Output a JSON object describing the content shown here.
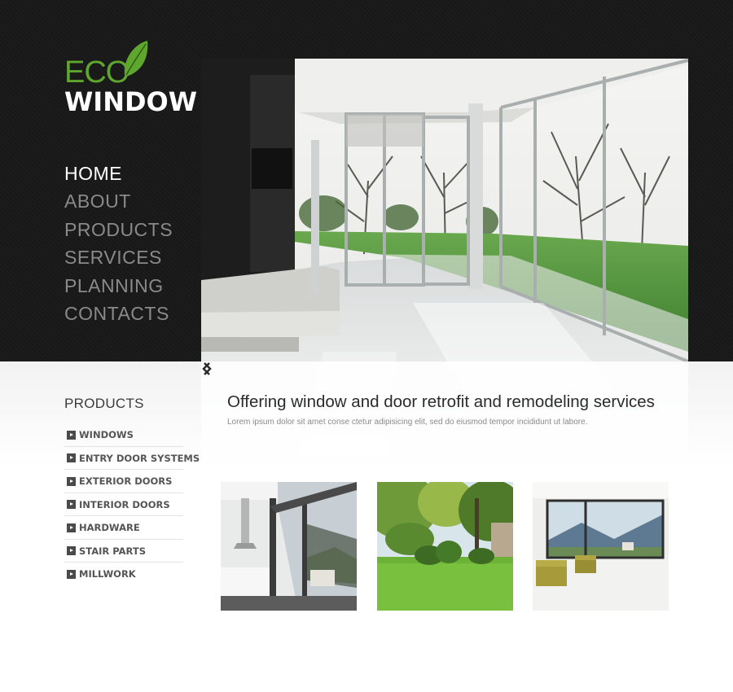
{
  "logo": {
    "eco": "ECO",
    "window": "WINDOW",
    "icon": "leaf-icon",
    "eco_color": "#5fa62f"
  },
  "nav": {
    "items": [
      {
        "label": "HOME",
        "active": true
      },
      {
        "label": "ABOUT",
        "active": false
      },
      {
        "label": "PRODUCTS",
        "active": false
      },
      {
        "label": "SERVICES",
        "active": false
      },
      {
        "label": "PLANNING",
        "active": false
      },
      {
        "label": "CONTACTS",
        "active": false
      }
    ]
  },
  "hero": {
    "title": "Offering window and door retrofit and remodeling services",
    "text": "Lorem ipsum dolor sit amet conse ctetur adipisicing elit, sed do eiusmod tempor incididunt ut labore.",
    "prev_icon": "chevron-left-icon",
    "next_icon": "chevron-right-icon"
  },
  "sidebar": {
    "title": "PRODUCTS",
    "items": [
      {
        "label": "WINDOWS"
      },
      {
        "label": "ENTRY DOOR SYSTEMS"
      },
      {
        "label": "EXTERIOR DOORS"
      },
      {
        "label": "INTERIOR DOORS"
      },
      {
        "label": "HARDWARE"
      },
      {
        "label": "STAIR PARTS"
      },
      {
        "label": "MILLWORK"
      }
    ]
  },
  "thumbnails": [
    {
      "subject": "modern-kitchen-window-photo"
    },
    {
      "subject": "garden-lawn-photo"
    },
    {
      "subject": "living-room-window-photo"
    }
  ]
}
